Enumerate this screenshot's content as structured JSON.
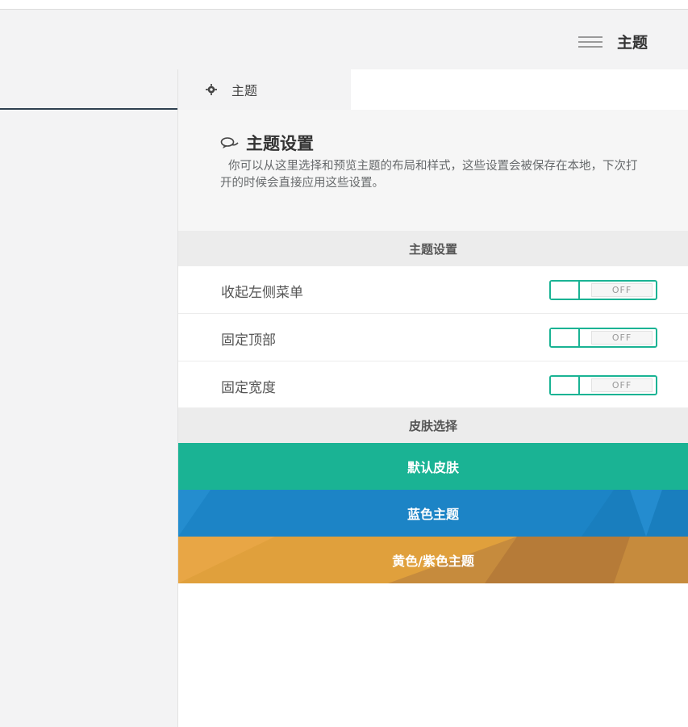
{
  "header": {
    "theme_toggle_label": "主题"
  },
  "panel": {
    "tab_label": "主题",
    "intro": {
      "title": "主题设置",
      "description": "你可以从这里选择和预览主题的布局和样式，这些设置会被保存在本地，下次打开的时候会直接应用这些设置。"
    },
    "settings_section_title": "主题设置",
    "settings": [
      {
        "label": "收起左侧菜单",
        "state": "OFF"
      },
      {
        "label": "固定顶部",
        "state": "OFF"
      },
      {
        "label": "固定宽度",
        "state": "OFF"
      }
    ],
    "skins_section_title": "皮肤选择",
    "skins": [
      {
        "label": "默认皮肤",
        "color": "#1ab394"
      },
      {
        "label": "蓝色主题",
        "color": "#1c84c6"
      },
      {
        "label": "黄色/紫色主题",
        "color": "#e0a03c"
      }
    ]
  },
  "colors": {
    "accent": "#1ab394",
    "sidebar_line": "#2f4050"
  }
}
